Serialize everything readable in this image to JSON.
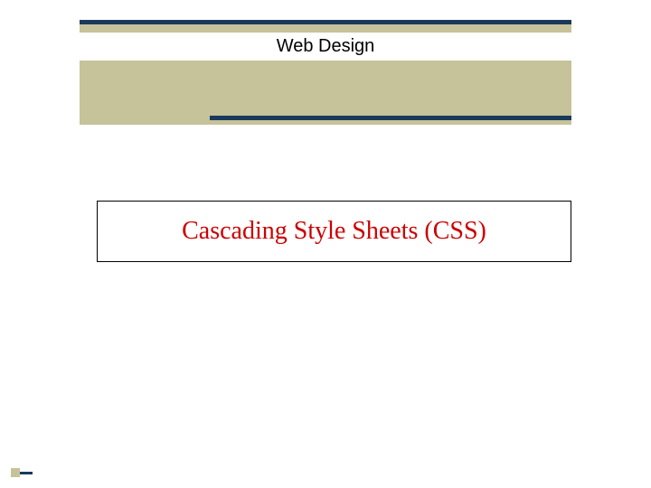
{
  "header": {
    "title": "Web Design"
  },
  "main": {
    "title": "Cascading Style Sheets (CSS)"
  },
  "colors": {
    "banner_bg": "#c6c29a",
    "accent_line": "#1a3a5c",
    "title_text": "#cc0000"
  }
}
